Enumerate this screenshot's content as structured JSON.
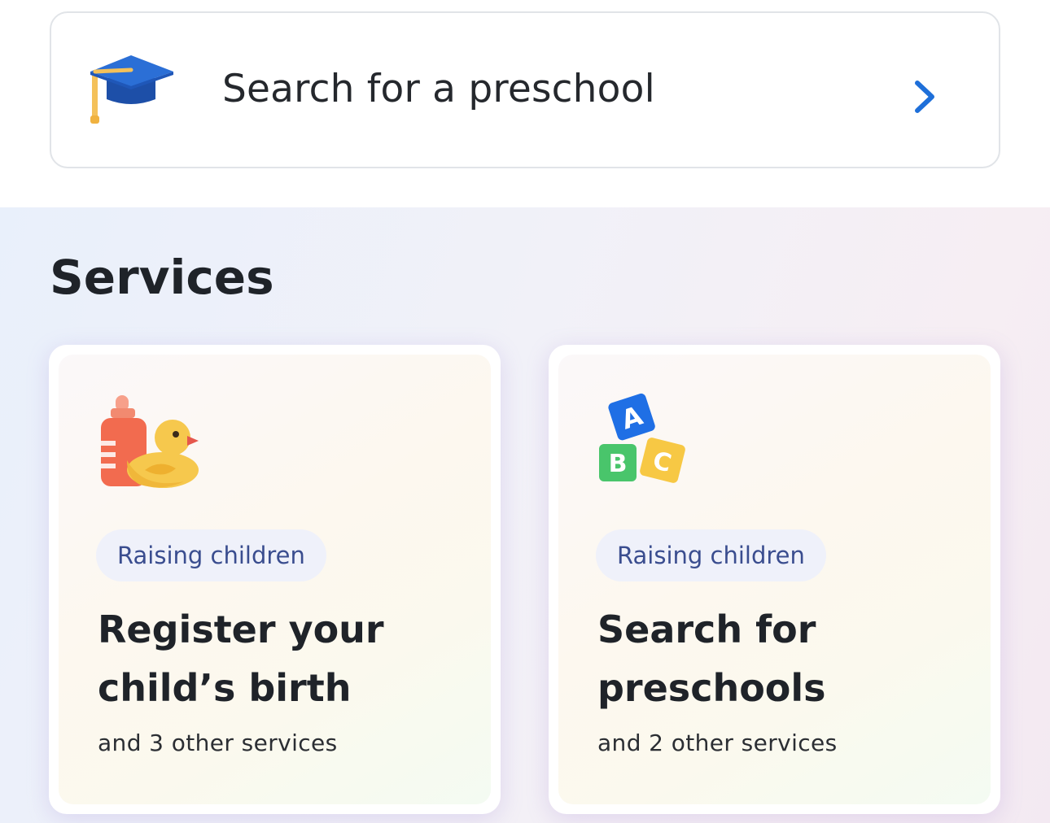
{
  "search_card": {
    "label": "Search for a preschool",
    "icon": "graduation-cap-icon",
    "chevron": "chevron-right-icon",
    "chevron_color": "#1e6fd9"
  },
  "services": {
    "title": "Services",
    "cards": [
      {
        "icon": "baby-bottle-duck-icon",
        "tag": "Raising children",
        "title_line1": "Register your",
        "title_line2": "child’s birth",
        "sub": "and 3 other services"
      },
      {
        "icon": "abc-blocks-icon",
        "tag": "Raising children",
        "title_line1": "Search for",
        "title_line2": "preschools",
        "sub": "and 2 other services"
      }
    ]
  },
  "colors": {
    "tag_text": "#3a4d8f",
    "accent": "#1e6fd9"
  }
}
